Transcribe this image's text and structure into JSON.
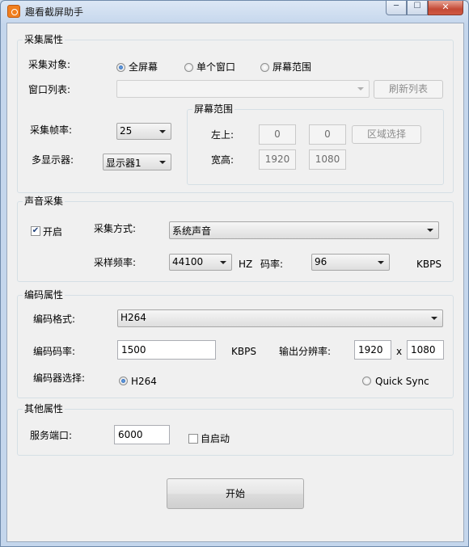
{
  "window": {
    "title": "趣看截屏助手",
    "icons": [
      "app-icon",
      "minimize-icon",
      "maximize-icon",
      "close-icon"
    ]
  },
  "capture": {
    "group_title": "采集属性",
    "target_label": "采集对象:",
    "target_options": [
      "全屏幕",
      "单个窗口",
      "屏幕范围"
    ],
    "target_selected": "全屏幕",
    "window_list_label": "窗口列表:",
    "window_list_value": "",
    "refresh_button": "刷新列表",
    "fps_label": "采集帧率:",
    "fps_value": "25",
    "monitor_label": "多显示器:",
    "monitor_value": "显示器1",
    "screen_range": {
      "group_title": "屏幕范围",
      "top_left_label": "左上:",
      "x": "0",
      "y": "0",
      "region_button": "区域选择",
      "size_label": "宽高:",
      "width": "1920",
      "height": "1080"
    }
  },
  "audio": {
    "group_title": "声音采集",
    "enable_label": "开启",
    "enabled": true,
    "mode_label": "采集方式:",
    "mode_value": "系统声音",
    "sample_rate_label": "采样频率:",
    "sample_rate_value": "44100",
    "sample_rate_unit": "HZ",
    "bitrate_label": "码率:",
    "bitrate_value": "96",
    "bitrate_unit": "KBPS"
  },
  "encode": {
    "group_title": "编码属性",
    "format_label": "编码格式:",
    "format_value": "H264",
    "bitrate_label": "编码码率:",
    "bitrate_value": "1500",
    "bitrate_unit": "KBPS",
    "resolution_label": "输出分辨率:",
    "res_width": "1920",
    "res_sep": "x",
    "res_height": "1080",
    "encoder_label": "编码器选择:",
    "encoder_options": [
      "H264",
      "Quick Sync"
    ],
    "encoder_selected": "H264"
  },
  "other": {
    "group_title": "其他属性",
    "port_label": "服务端口:",
    "port_value": "6000",
    "autostart_label": "自启动",
    "autostart": false
  },
  "start_button": "开始"
}
